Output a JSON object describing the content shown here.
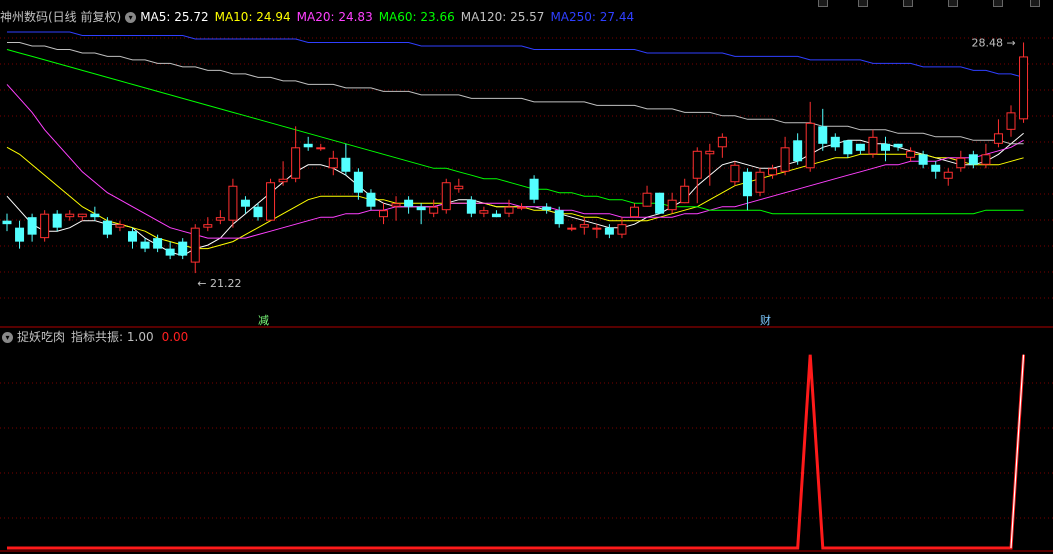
{
  "header": {
    "title": "神州数码(日线 前复权)",
    "ma": [
      {
        "label": "MA5: 25.72",
        "color": "#ffffff"
      },
      {
        "label": "MA10: 24.94",
        "color": "#ffff00"
      },
      {
        "label": "MA20: 24.83",
        "color": "#ff40ff"
      },
      {
        "label": "MA60: 23.66",
        "color": "#00ff00"
      },
      {
        "label": "MA120: 25.57",
        "color": "#c0c0c0"
      },
      {
        "label": "MA250: 27.44",
        "color": "#2f3fff"
      }
    ]
  },
  "indicator": {
    "title": "捉妖吃肉",
    "label": "指标共振: 1.00",
    "value": "0.00",
    "value_color": "#ff2020"
  },
  "colors": {
    "up": "#ff3030",
    "down": "#54ffff",
    "grid": "#7a0000",
    "separator": "#b00000"
  },
  "chart_data": {
    "type": "candlestick",
    "price_ylim": [
      20.5,
      29.0
    ],
    "annotations": {
      "high_label": "28.48",
      "low_label": "21.22",
      "event_1": "减",
      "event_2": "财"
    },
    "candles": [
      [
        23.4,
        23.3,
        23.6,
        23.1
      ],
      [
        23.2,
        22.8,
        23.4,
        22.6
      ],
      [
        23.5,
        23.0,
        23.6,
        22.8
      ],
      [
        22.9,
        23.6,
        23.7,
        22.8
      ],
      [
        23.6,
        23.2,
        23.7,
        23.1
      ],
      [
        23.5,
        23.6,
        23.7,
        23.4
      ],
      [
        23.5,
        23.6,
        23.6,
        23.4
      ],
      [
        23.6,
        23.5,
        23.8,
        23.4
      ],
      [
        23.4,
        23.0,
        23.5,
        22.9
      ],
      [
        23.2,
        23.3,
        23.4,
        23.1
      ],
      [
        23.1,
        22.8,
        23.2,
        22.6
      ],
      [
        22.8,
        22.6,
        22.9,
        22.5
      ],
      [
        22.9,
        22.6,
        23.0,
        22.5
      ],
      [
        22.6,
        22.4,
        22.8,
        22.3
      ],
      [
        22.8,
        22.4,
        22.9,
        22.3
      ],
      [
        22.2,
        23.2,
        23.3,
        21.9
      ],
      [
        23.2,
        23.3,
        23.5,
        23.1
      ],
      [
        23.4,
        23.5,
        23.7,
        23.3
      ],
      [
        23.4,
        24.4,
        24.6,
        23.2
      ],
      [
        24.0,
        23.8,
        24.1,
        23.6
      ],
      [
        23.8,
        23.5,
        23.9,
        23.4
      ],
      [
        23.4,
        24.5,
        24.6,
        23.4
      ],
      [
        24.5,
        24.6,
        25.1,
        24.4
      ],
      [
        24.6,
        25.5,
        26.1,
        24.5
      ],
      [
        25.6,
        25.5,
        25.8,
        25.4
      ],
      [
        25.5,
        25.5,
        25.6,
        25.4
      ],
      [
        24.9,
        25.2,
        25.4,
        24.7
      ],
      [
        25.2,
        24.8,
        25.6,
        24.7
      ],
      [
        24.8,
        24.2,
        24.9,
        24.0
      ],
      [
        24.2,
        23.8,
        24.3,
        23.7
      ],
      [
        23.5,
        23.7,
        23.9,
        23.3
      ],
      [
        23.8,
        23.9,
        24.1,
        23.4
      ],
      [
        24.0,
        23.8,
        24.1,
        23.6
      ],
      [
        23.8,
        23.7,
        23.9,
        23.3
      ],
      [
        23.6,
        23.8,
        24.0,
        23.5
      ],
      [
        23.7,
        24.5,
        24.6,
        23.6
      ],
      [
        24.3,
        24.4,
        24.6,
        24.2
      ],
      [
        24.0,
        23.6,
        24.1,
        23.5
      ],
      [
        23.6,
        23.7,
        23.8,
        23.5
      ],
      [
        23.6,
        23.5,
        23.7,
        23.5
      ],
      [
        23.6,
        23.8,
        24.0,
        23.5
      ],
      [
        23.8,
        23.8,
        23.9,
        23.7
      ],
      [
        24.6,
        24.0,
        24.7,
        23.9
      ],
      [
        23.8,
        23.7,
        23.9,
        23.6
      ],
      [
        23.7,
        23.3,
        23.8,
        23.2
      ],
      [
        23.2,
        23.2,
        23.3,
        23.1
      ],
      [
        23.2,
        23.3,
        23.5,
        23.0
      ],
      [
        23.2,
        23.2,
        23.3,
        22.9
      ],
      [
        23.2,
        23.0,
        23.3,
        22.9
      ],
      [
        23.0,
        23.3,
        23.5,
        22.9
      ],
      [
        23.5,
        23.8,
        23.9,
        23.5
      ],
      [
        23.8,
        24.2,
        24.4,
        23.8
      ],
      [
        24.2,
        23.6,
        24.2,
        23.6
      ],
      [
        23.7,
        24.0,
        24.2,
        23.6
      ],
      [
        23.9,
        24.4,
        24.6,
        23.9
      ],
      [
        24.6,
        25.4,
        25.5,
        23.9
      ],
      [
        25.3,
        25.4,
        25.6,
        24.4
      ],
      [
        25.5,
        25.8,
        25.9,
        25.2
      ],
      [
        24.5,
        25.0,
        25.1,
        24.4
      ],
      [
        24.8,
        24.1,
        24.9,
        23.7
      ],
      [
        24.2,
        24.8,
        24.9,
        24.1
      ],
      [
        24.7,
        24.9,
        25.0,
        24.6
      ],
      [
        24.8,
        25.5,
        25.8,
        24.7
      ],
      [
        25.7,
        25.1,
        25.9,
        25.0
      ],
      [
        24.9,
        26.2,
        26.8,
        24.8
      ],
      [
        26.1,
        25.6,
        26.6,
        25.4
      ],
      [
        25.8,
        25.5,
        25.9,
        25.4
      ],
      [
        25.7,
        25.3,
        25.7,
        25.2
      ],
      [
        25.6,
        25.4,
        25.6,
        25.3
      ],
      [
        25.3,
        25.8,
        26.0,
        25.2
      ],
      [
        25.6,
        25.4,
        25.8,
        25.1
      ],
      [
        25.6,
        25.5,
        25.6,
        25.4
      ],
      [
        25.2,
        25.4,
        25.5,
        25.1
      ],
      [
        25.3,
        25.0,
        25.4,
        24.9
      ],
      [
        25.0,
        24.8,
        25.1,
        24.6
      ],
      [
        24.6,
        24.8,
        24.9,
        24.4
      ],
      [
        24.9,
        25.2,
        25.4,
        24.8
      ],
      [
        25.3,
        25.0,
        25.4,
        24.9
      ],
      [
        25.0,
        25.3,
        25.6,
        24.9
      ],
      [
        25.6,
        25.9,
        26.3,
        25.5
      ],
      [
        26.0,
        26.5,
        26.7,
        25.8
      ],
      [
        26.3,
        28.1,
        28.5,
        26.2
      ]
    ],
    "ma_series": [
      {
        "name": "MA5",
        "color": "#ffffff",
        "values": [
          24.1,
          23.7,
          23.3,
          23.1,
          23.1,
          23.2,
          23.4,
          23.4,
          23.3,
          23.3,
          23.2,
          22.9,
          22.7,
          22.5,
          22.4,
          22.6,
          22.7,
          22.9,
          23.3,
          23.6,
          23.9,
          24.2,
          24.5,
          24.8,
          25.0,
          25.0,
          24.9,
          24.7,
          24.4,
          24.1,
          23.9,
          23.8,
          23.8,
          23.8,
          23.8,
          23.9,
          24.0,
          24.0,
          23.9,
          23.8,
          23.8,
          23.8,
          23.8,
          23.7,
          23.6,
          23.5,
          23.4,
          23.3,
          23.2,
          23.2,
          23.3,
          23.5,
          23.6,
          23.8,
          24.0,
          24.4,
          24.7,
          25.0,
          25.1,
          25.0,
          24.9,
          24.9,
          25.0,
          25.1,
          25.3,
          25.5,
          25.6,
          25.7,
          25.7,
          25.6,
          25.6,
          25.5,
          25.4,
          25.3,
          25.2,
          25.1,
          25.0,
          25.0,
          25.1,
          25.3,
          25.6,
          25.9
        ]
      },
      {
        "name": "MA10",
        "color": "#ffff00",
        "values": [
          25.5,
          25.3,
          25.0,
          24.7,
          24.4,
          24.1,
          23.8,
          23.6,
          23.4,
          23.3,
          23.2,
          23.1,
          22.9,
          22.8,
          22.7,
          22.6,
          22.6,
          22.7,
          22.8,
          23.0,
          23.2,
          23.4,
          23.6,
          23.8,
          24.0,
          24.1,
          24.1,
          24.1,
          24.1,
          24.0,
          24.0,
          23.9,
          23.9,
          23.9,
          23.9,
          23.9,
          23.9,
          23.9,
          23.9,
          23.8,
          23.8,
          23.8,
          23.7,
          23.7,
          23.6,
          23.6,
          23.5,
          23.5,
          23.4,
          23.4,
          23.4,
          23.4,
          23.5,
          23.6,
          23.7,
          23.8,
          24.0,
          24.2,
          24.4,
          24.5,
          24.6,
          24.7,
          24.8,
          24.9,
          25.0,
          25.1,
          25.2,
          25.2,
          25.3,
          25.3,
          25.3,
          25.3,
          25.3,
          25.3,
          25.2,
          25.2,
          25.1,
          25.0,
          25.0,
          25.0,
          25.1,
          25.2
        ]
      },
      {
        "name": "MA20",
        "color": "#ff40ff",
        "values": [
          27.3,
          26.9,
          26.5,
          26.0,
          25.6,
          25.2,
          24.8,
          24.5,
          24.2,
          24.0,
          23.8,
          23.6,
          23.4,
          23.2,
          23.1,
          23.0,
          22.9,
          22.9,
          22.9,
          22.9,
          23.0,
          23.1,
          23.2,
          23.3,
          23.4,
          23.5,
          23.5,
          23.6,
          23.6,
          23.7,
          23.7,
          23.8,
          23.8,
          23.8,
          23.8,
          23.9,
          23.9,
          23.9,
          23.9,
          23.9,
          23.9,
          23.8,
          23.8,
          23.8,
          23.7,
          23.7,
          23.6,
          23.6,
          23.6,
          23.5,
          23.5,
          23.5,
          23.5,
          23.5,
          23.6,
          23.6,
          23.7,
          23.8,
          23.8,
          23.9,
          24.0,
          24.1,
          24.2,
          24.3,
          24.4,
          24.5,
          24.6,
          24.7,
          24.8,
          24.9,
          25.0,
          25.0,
          25.1,
          25.1,
          25.1,
          25.2,
          25.2,
          25.2,
          25.3,
          25.4,
          25.5,
          25.7
        ]
      },
      {
        "name": "MA60",
        "color": "#00ff00",
        "values": [
          28.3,
          28.2,
          28.1,
          28.0,
          27.9,
          27.8,
          27.7,
          27.6,
          27.5,
          27.4,
          27.3,
          27.2,
          27.1,
          27.0,
          26.9,
          26.8,
          26.7,
          26.6,
          26.5,
          26.4,
          26.3,
          26.2,
          26.1,
          26.0,
          25.9,
          25.8,
          25.7,
          25.6,
          25.5,
          25.4,
          25.3,
          25.2,
          25.1,
          25.0,
          24.9,
          24.9,
          24.8,
          24.7,
          24.6,
          24.6,
          24.5,
          24.4,
          24.3,
          24.3,
          24.2,
          24.2,
          24.1,
          24.1,
          24.0,
          24.0,
          23.9,
          23.9,
          23.9,
          23.8,
          23.8,
          23.8,
          23.7,
          23.7,
          23.7,
          23.7,
          23.7,
          23.6,
          23.6,
          23.6,
          23.6,
          23.6,
          23.6,
          23.6,
          23.6,
          23.6,
          23.6,
          23.6,
          23.6,
          23.6,
          23.6,
          23.6,
          23.6,
          23.6,
          23.7,
          23.7,
          23.7,
          23.7
        ]
      },
      {
        "name": "MA120",
        "color": "#c0c0c0",
        "values": [
          28.5,
          28.5,
          28.4,
          28.4,
          28.3,
          28.3,
          28.2,
          28.2,
          28.1,
          28.1,
          28.0,
          28.0,
          27.9,
          27.9,
          27.8,
          27.8,
          27.7,
          27.7,
          27.6,
          27.6,
          27.5,
          27.5,
          27.4,
          27.4,
          27.3,
          27.3,
          27.3,
          27.2,
          27.2,
          27.2,
          27.1,
          27.1,
          27.1,
          27.0,
          27.0,
          27.0,
          27.0,
          26.9,
          26.9,
          26.9,
          26.9,
          26.9,
          26.8,
          26.8,
          26.8,
          26.8,
          26.8,
          26.7,
          26.7,
          26.7,
          26.7,
          26.6,
          26.6,
          26.6,
          26.5,
          26.5,
          26.5,
          26.4,
          26.4,
          26.3,
          26.3,
          26.3,
          26.2,
          26.2,
          26.2,
          26.1,
          26.1,
          26.1,
          26.0,
          26.0,
          26.0,
          25.9,
          25.9,
          25.9,
          25.8,
          25.8,
          25.8,
          25.7,
          25.7,
          25.7,
          25.6,
          25.6
        ]
      },
      {
        "name": "MA250",
        "color": "#2f3fff",
        "values": [
          28.8,
          28.8,
          28.8,
          28.8,
          28.8,
          28.8,
          28.7,
          28.7,
          28.7,
          28.7,
          28.7,
          28.7,
          28.7,
          28.7,
          28.7,
          28.6,
          28.6,
          28.6,
          28.6,
          28.6,
          28.6,
          28.6,
          28.6,
          28.6,
          28.5,
          28.5,
          28.5,
          28.5,
          28.5,
          28.5,
          28.5,
          28.5,
          28.5,
          28.4,
          28.4,
          28.4,
          28.4,
          28.4,
          28.4,
          28.4,
          28.4,
          28.4,
          28.3,
          28.3,
          28.3,
          28.3,
          28.3,
          28.3,
          28.3,
          28.3,
          28.3,
          28.2,
          28.2,
          28.2,
          28.2,
          28.2,
          28.2,
          28.2,
          28.1,
          28.1,
          28.1,
          28.1,
          28.1,
          28.1,
          28.0,
          28.0,
          28.0,
          28.0,
          28.0,
          27.9,
          27.9,
          27.9,
          27.9,
          27.8,
          27.8,
          27.8,
          27.8,
          27.7,
          27.7,
          27.6,
          27.6,
          27.5
        ]
      }
    ],
    "indicator": {
      "ylim": [
        0,
        1.05
      ],
      "values": [
        0,
        0,
        0,
        0,
        0,
        0,
        0,
        0,
        0,
        0,
        0,
        0,
        0,
        0,
        0,
        0,
        0,
        0,
        0,
        0,
        0,
        0,
        0,
        0,
        0,
        0,
        0,
        0,
        0,
        0,
        0,
        0,
        0,
        0,
        0,
        0,
        0,
        0,
        0,
        0,
        0,
        0,
        0,
        0,
        0,
        0,
        0,
        0,
        0,
        0,
        0,
        0,
        0,
        0,
        0,
        0,
        0,
        0,
        0,
        0,
        0,
        0,
        0,
        0,
        1,
        0,
        0,
        0,
        0,
        0,
        0,
        0,
        0,
        0,
        0,
        0,
        0,
        0,
        0,
        0,
        0,
        1
      ]
    }
  }
}
